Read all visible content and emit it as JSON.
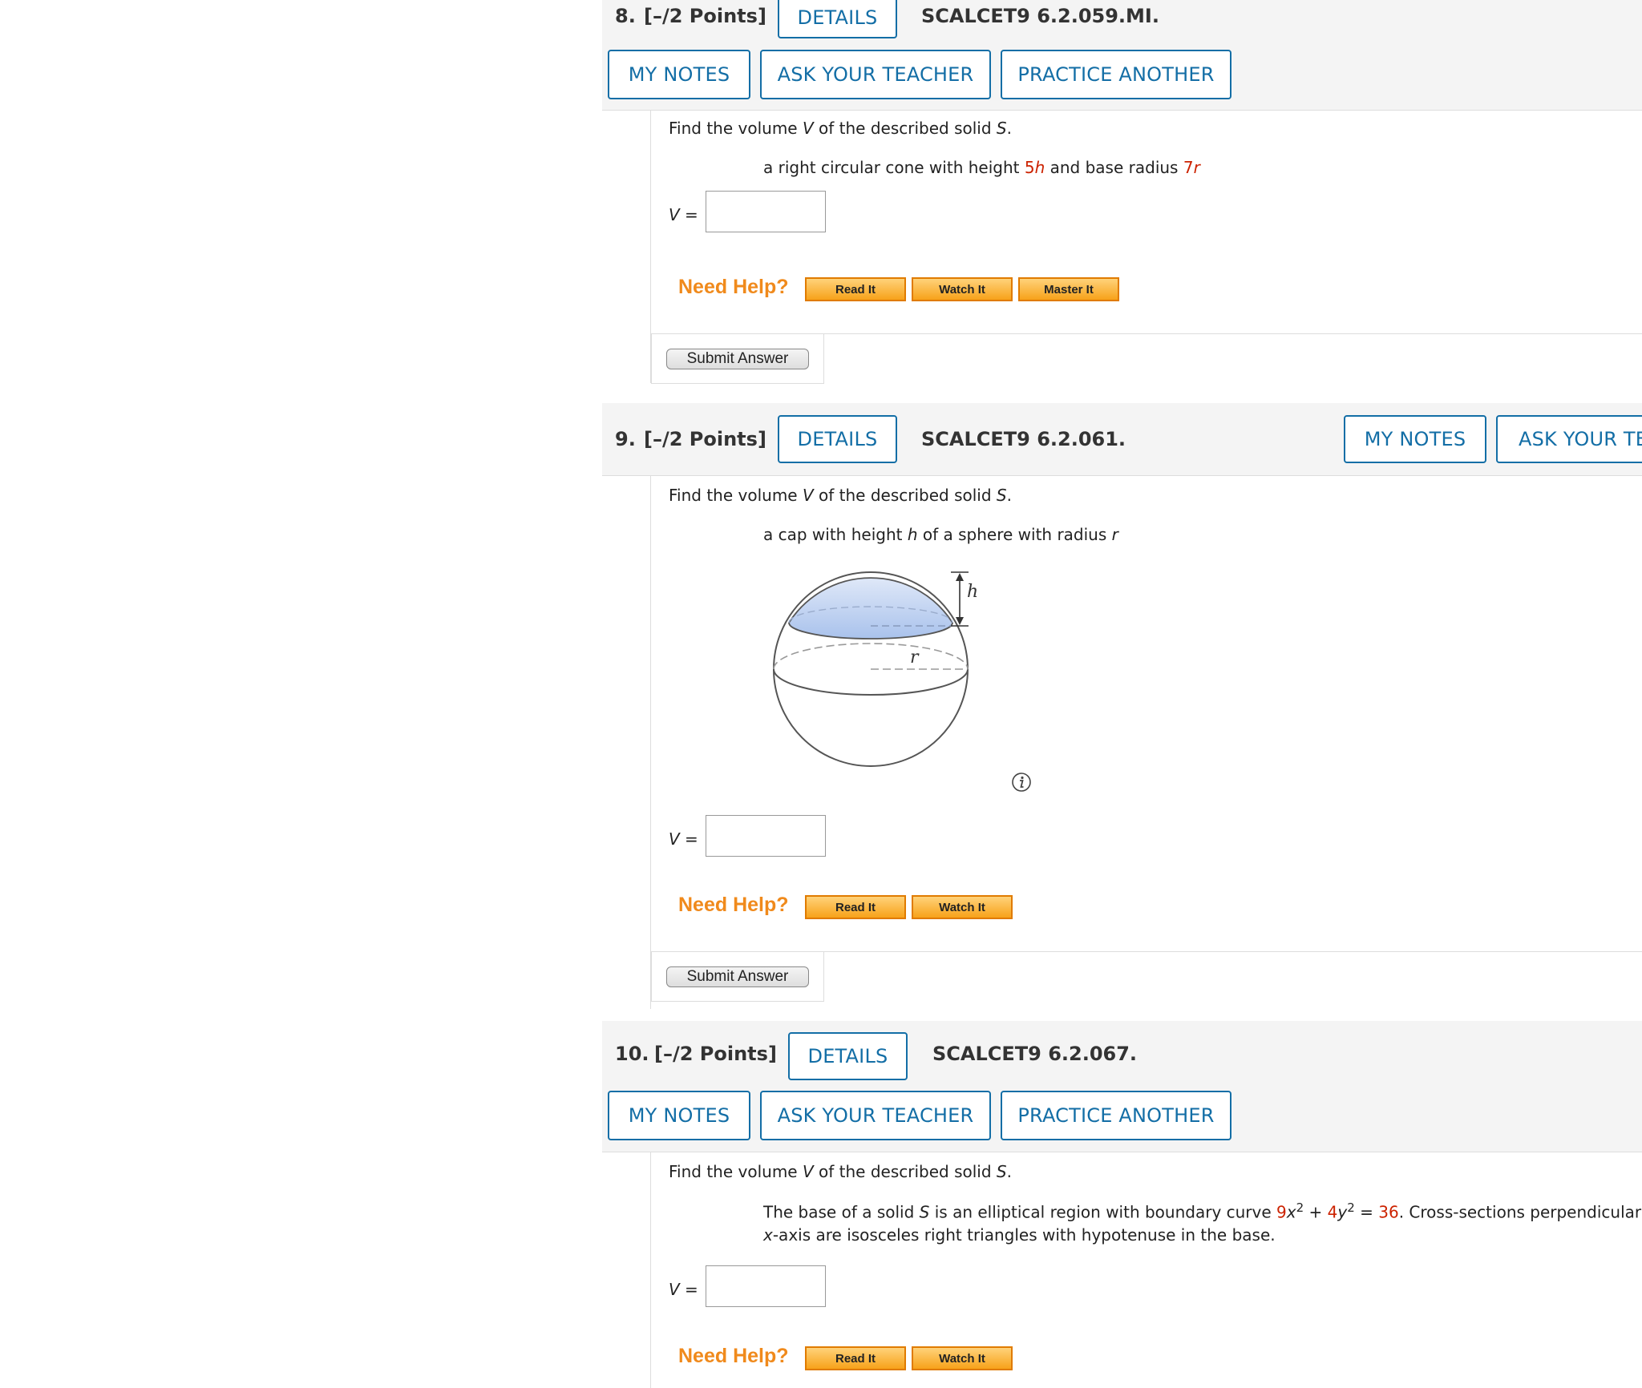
{
  "questions": [
    {
      "number": "8.",
      "points": "[–/2 Points]",
      "details": "DETAILS",
      "ref": "SCALCET9 6.2.059.MI.",
      "my_notes": "MY NOTES",
      "ask_teacher": "ASK YOUR TEACHER",
      "practice": "PRACTICE ANOTHER",
      "prompt_pre": "Find the volume ",
      "prompt_v": "V",
      "prompt_mid": " of the described solid ",
      "prompt_s": "S",
      "prompt_end": ".",
      "desc_pre": "a right circular cone with height ",
      "desc_h_coef": "5",
      "desc_h_var": "h",
      "desc_mid": " and base radius ",
      "desc_r_coef": "7",
      "desc_r_var": "r",
      "v_label": "V =",
      "answer_value": "",
      "need_help": "Need Help?",
      "help_buttons": [
        "Read It",
        "Watch It",
        "Master It"
      ],
      "submit": "Submit Answer"
    },
    {
      "number": "9.",
      "points": "[–/2 Points]",
      "details": "DETAILS",
      "ref": "SCALCET9 6.2.061.",
      "my_notes": "MY NOTES",
      "ask_teacher": "ASK YOUR TE",
      "prompt_pre": "Find the volume ",
      "prompt_v": "V",
      "prompt_mid": " of the described solid ",
      "prompt_s": "S",
      "prompt_end": ".",
      "desc_pre": "a cap with height ",
      "desc_h": "h",
      "desc_mid": " of a sphere with radius ",
      "desc_r": "r",
      "figure_labels": {
        "h": "h",
        "r": "r"
      },
      "info_icon": "info-icon",
      "v_label": "V =",
      "answer_value": "",
      "need_help": "Need Help?",
      "help_buttons": [
        "Read It",
        "Watch It"
      ],
      "submit": "Submit Answer"
    },
    {
      "number": "10.",
      "points": "[–/2 Points]",
      "details": "DETAILS",
      "ref": "SCALCET9 6.2.067.",
      "my_notes": "MY NOTES",
      "ask_teacher": "ASK YOUR TEACHER",
      "practice": "PRACTICE ANOTHER",
      "prompt_pre": "Find the volume ",
      "prompt_v": "V",
      "prompt_mid": " of the described solid ",
      "prompt_s": "S",
      "prompt_end": ".",
      "desc_line1_pre": "The base of a solid ",
      "desc_line1_s": "S",
      "desc_line1_mid": " is an elliptical region with boundary curve ",
      "eq_a": "9",
      "eq_x": "x",
      "eq_exp1": "2",
      "eq_plus": " + ",
      "eq_b": "4",
      "eq_y": "y",
      "eq_exp2": "2",
      "eq_eq": " = ",
      "eq_c": "36",
      "desc_line1_end": ". Cross-sections perpendicular",
      "desc_line2_x": "x",
      "desc_line2": "-axis are isosceles right triangles with hypotenuse in the base.",
      "v_label": "V =",
      "answer_value": "",
      "need_help": "Need Help?",
      "help_buttons": [
        "Read It",
        "Watch It"
      ]
    }
  ],
  "colors": {
    "accent_blue": "#136ea6",
    "help_orange": "#f08a1c",
    "given_red": "#cc2200",
    "header_bg": "#f4f4f4",
    "cap_fill": "#c5d6f2"
  }
}
